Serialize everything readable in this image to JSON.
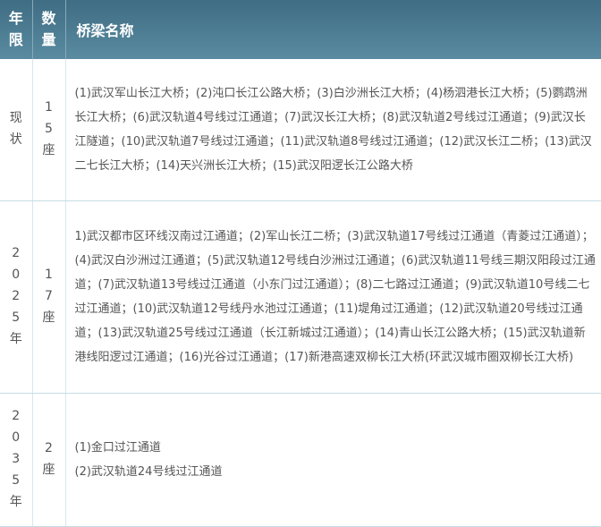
{
  "header": {
    "col1": "年限",
    "col2": "数量",
    "col3": "桥梁名称"
  },
  "rows": [
    {
      "year": "现状",
      "count": "15座",
      "names": "(1)武汉军山长江大桥；(2)沌口长江公路大桥；(3)白沙洲长江大桥；(4)杨泗港长江大桥；(5)鹦鹉洲长江大桥；(6)武汉轨道4号线过江通道；(7)武汉长江大桥；(8)武汉轨道2号线过江通道；(9)武汉长江隧道；(10)武汉轨道7号线过江通道；(11)武汉轨道8号线过江通道；(12)武汉长江二桥；(13)武汉二七长江大桥；(14)天兴洲长江大桥；(15)武汉阳逻长江公路大桥"
    },
    {
      "year": "2025年",
      "count": "17座",
      "names": "1)武汉都市区环线汉南过江通道；(2)军山长江二桥；(3)武汉轨道17号线过江通道（青菱过江通道）；(4)武汉白沙洲过江通道；(5)武汉轨道12号线白沙洲过江通道；(6)武汉轨道11号线三期汉阳段过江通道；(7)武汉轨道13号线过江通道（小东门过江通道）；(8)二七路过江通道；(9)武汉轨道10号线二七过江通道；(10)武汉轨道12号线丹水池过江通道；(11)堤角过江通道；(12)武汉轨道20号线过江通道；(13)武汉轨道25号线过江通道（长江新城过江通道）；(14)青山长江公路大桥；(15)武汉轨道新港线阳逻过江通道；(16)光谷过江通道；(17)新港高速双柳长江大桥(环武汉城市圈双柳长江大桥)"
    },
    {
      "year": "2035年",
      "count": "2座",
      "names": [
        "(1)金口过江通道",
        "(2)武汉轨道24号线过江通道"
      ]
    }
  ]
}
